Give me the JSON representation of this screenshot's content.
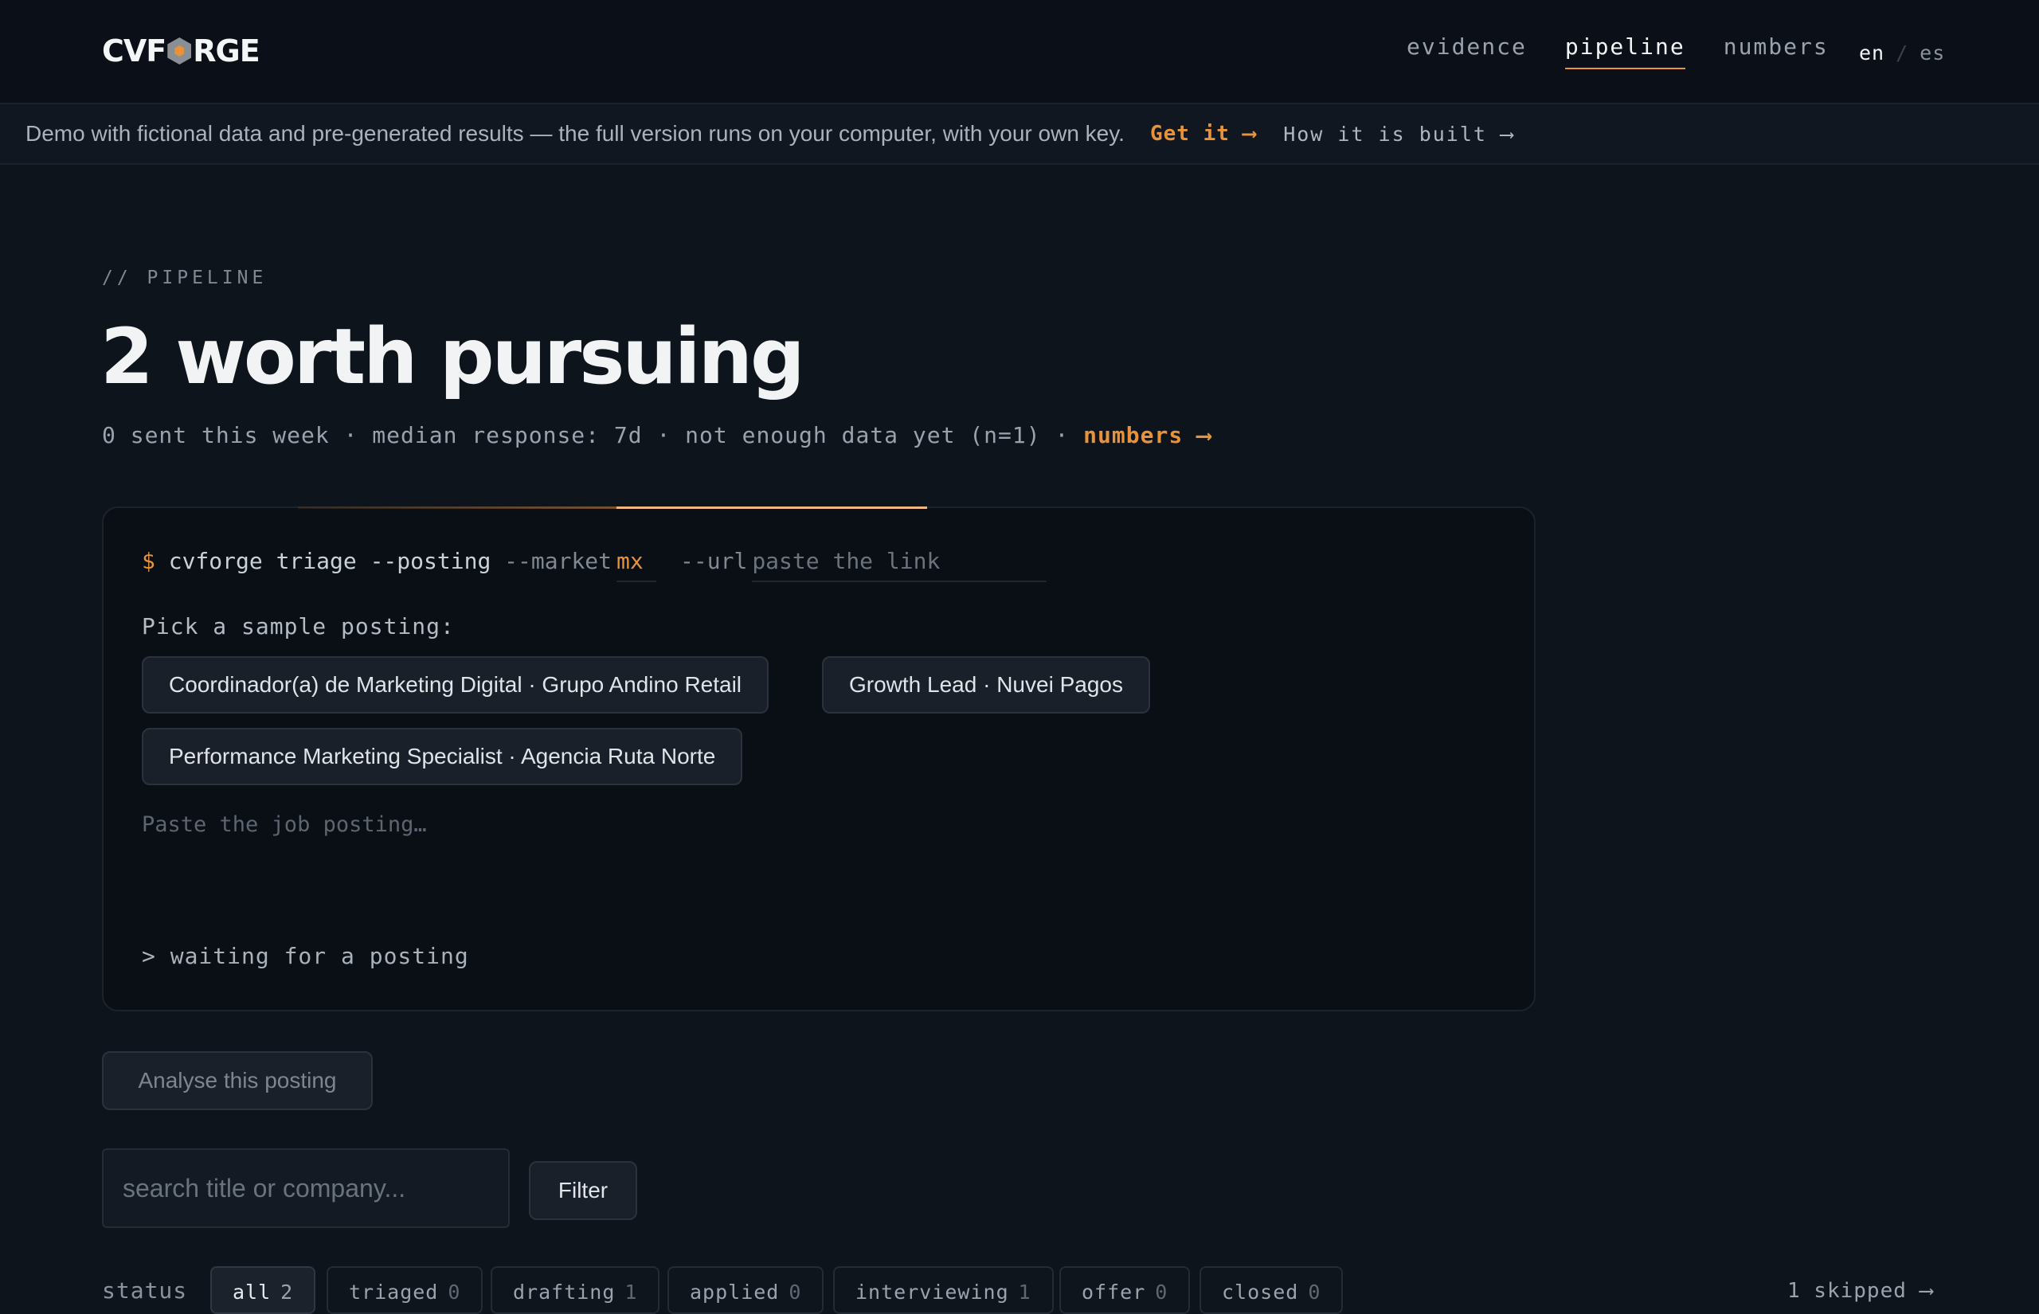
{
  "brand": {
    "logo_left": "CVF",
    "logo_right": "RGE"
  },
  "nav": {
    "items": [
      {
        "label": "evidence"
      },
      {
        "label": "pipeline"
      },
      {
        "label": "numbers"
      }
    ],
    "active": "pipeline",
    "lang": {
      "current": "en",
      "separator": "/",
      "other": "es"
    }
  },
  "banner": {
    "message": "Demo with fictional data and pre-generated results — the full version runs on your computer, with your own key.",
    "get_it": "Get it ⟶",
    "how_built": "How it is built ⟶"
  },
  "page": {
    "eyebrow": "// PIPELINE",
    "title": "2 worth pursuing",
    "stats": "0 sent this week · median response: 7d · not enough data yet (n=1) · ",
    "stats_link": "numbers ⟶"
  },
  "terminal": {
    "prompt": "$",
    "command": " cvforge triage --posting ",
    "market_flag": "--market",
    "market_value": "mx",
    "url_flag": "--url",
    "url_placeholder": "paste the link",
    "pick_label": "Pick a sample posting:",
    "samples": [
      "Coordinador(a) de Marketing Digital · Grupo Andino Retail",
      "Growth Lead · Nuvei Pagos",
      "Performance Marketing Specialist · Agencia Ruta Norte"
    ],
    "textarea_placeholder": "Paste the job posting…",
    "status": "> waiting for a posting"
  },
  "actions": {
    "analyse": "Analyse this posting"
  },
  "search": {
    "placeholder": "search title or company...",
    "filter_label": "Filter"
  },
  "status_filter": {
    "label": "status",
    "pills": [
      {
        "label": "all",
        "count": "2"
      },
      {
        "label": "triaged",
        "count": "0"
      },
      {
        "label": "drafting",
        "count": "1"
      },
      {
        "label": "applied",
        "count": "0"
      },
      {
        "label": "interviewing",
        "count": "1"
      },
      {
        "label": "offer",
        "count": "0"
      },
      {
        "label": "closed",
        "count": "0"
      }
    ],
    "active": "all",
    "skipped": "1 skipped ⟶"
  },
  "colors": {
    "accent": "#e8923a",
    "background": "#0e141c"
  }
}
